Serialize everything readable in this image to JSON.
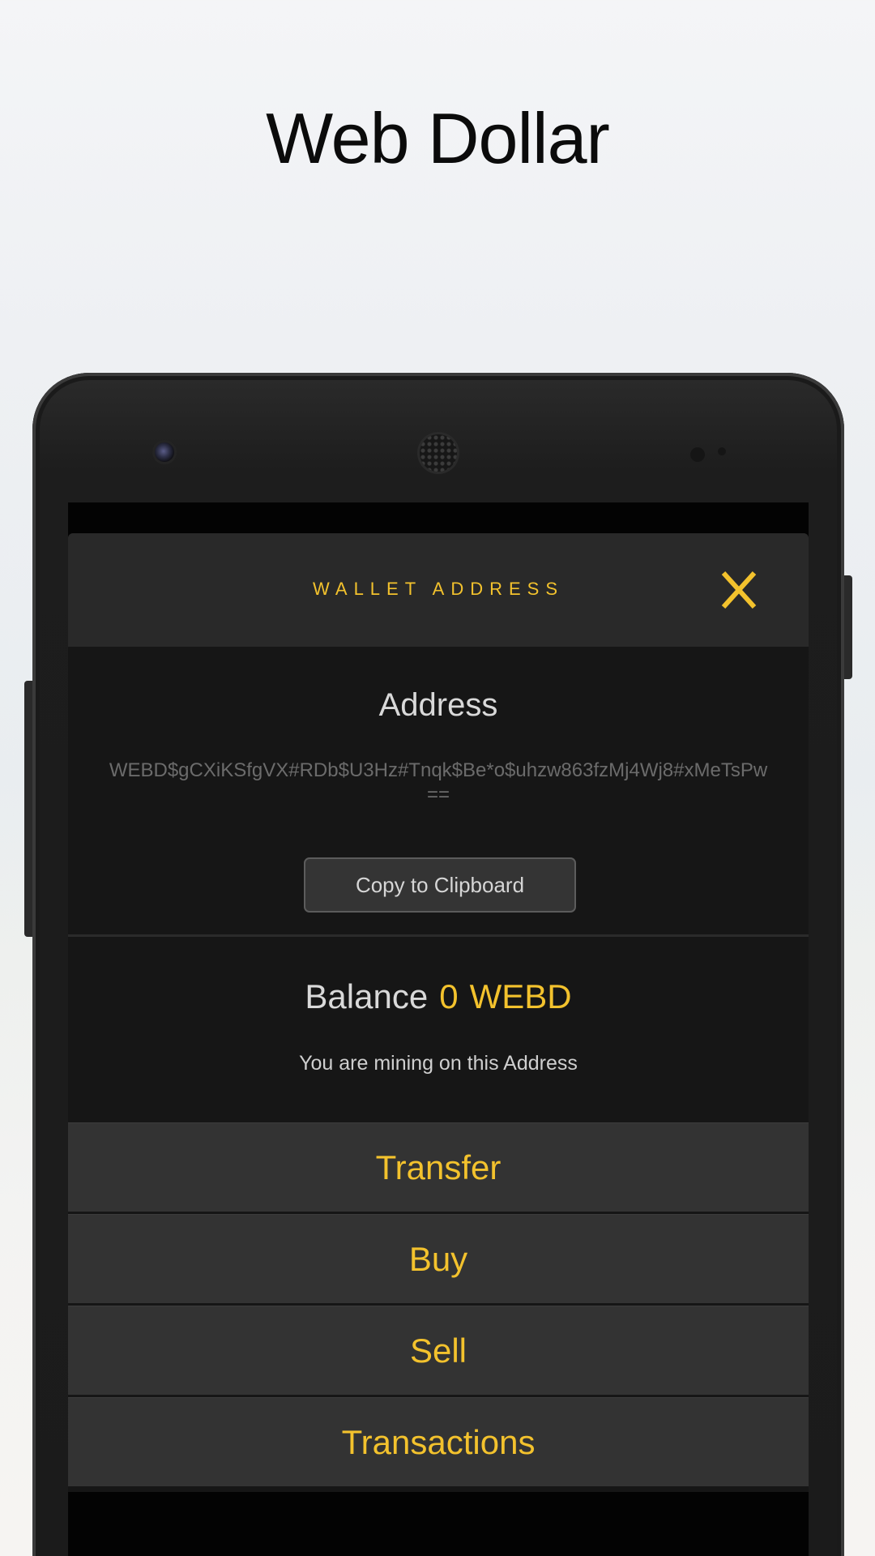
{
  "promo": {
    "title": "Web Dollar"
  },
  "modal": {
    "title": "WALLET ADDRESS",
    "close_label": "X",
    "close_icon": "close-x-icon",
    "accent_color": "#f3c22d"
  },
  "address": {
    "heading": "Address",
    "value": "WEBD$gCXiKSfgVX#RDb$U3Hz#Tnqk$Be*o$uhzw863fzMj4Wj8#xMeTsPw==",
    "copy_button": "Copy to Clipboard"
  },
  "balance": {
    "label": "Balance",
    "amount": "0",
    "unit": "WEBD",
    "mining_note": "You are mining on this Address"
  },
  "actions": [
    {
      "label": "Transfer"
    },
    {
      "label": "Buy"
    },
    {
      "label": "Sell"
    },
    {
      "label": "Transactions"
    }
  ]
}
